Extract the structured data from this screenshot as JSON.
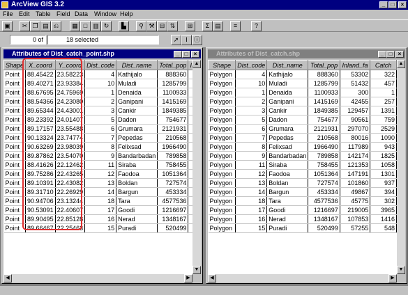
{
  "app": {
    "title": "ArcView GIS 3.2"
  },
  "menu": [
    "File",
    "Edit",
    "Table",
    "Field",
    "Data",
    "Window",
    "Help"
  ],
  "selection": {
    "selected_count": "0",
    "of_label": "of",
    "total": "18 selected"
  },
  "left_table": {
    "title": "Attributes of Dist_catch_point.shp",
    "columns": [
      "Shape",
      "X_coord",
      "Y_coord",
      "Dist_code",
      "Dist_name",
      "Total_pop",
      "In"
    ],
    "rows": [
      [
        "Point",
        "88.45422",
        "23.58223",
        "4",
        "Kathijalo",
        "888360",
        ""
      ],
      [
        "Point",
        "89.40271",
        "23.93384",
        "10",
        "Muladi",
        "1285799",
        ""
      ],
      [
        "Point",
        "88.67695",
        "24.75969",
        "1",
        "Denaida",
        "1100933",
        ""
      ],
      [
        "Point",
        "88.54366",
        "24.23080",
        "2",
        "Ganipani",
        "1415169",
        ""
      ],
      [
        "Point",
        "89.65344",
        "24.43001",
        "3",
        "Cankir",
        "1849385",
        ""
      ],
      [
        "Point",
        "89.23392",
        "24.01407",
        "5",
        "Dadon",
        "754677",
        ""
      ],
      [
        "Point",
        "89.17157",
        "23.55488",
        "6",
        "Grumara",
        "2121931",
        ""
      ],
      [
        "Point",
        "90.13324",
        "23.74774",
        "7",
        "Pepedas",
        "210568",
        ""
      ],
      [
        "Point",
        "90.63269",
        "23.98039",
        "8",
        "Felixsad",
        "1966490",
        ""
      ],
      [
        "Point",
        "89.87862",
        "23.54070",
        "9",
        "Bandarbadan",
        "789858",
        ""
      ],
      [
        "Point",
        "88.41626",
        "22.12462",
        "11",
        "Siraba",
        "758455",
        ""
      ],
      [
        "Point",
        "89.75286",
        "22.43265",
        "12",
        "Faodoa",
        "1051364",
        ""
      ],
      [
        "Point",
        "89.10391",
        "22.43082",
        "13",
        "Boldan",
        "727574",
        ""
      ],
      [
        "Point",
        "89.31710",
        "22.26929",
        "14",
        "Bargun",
        "453334",
        ""
      ],
      [
        "Point",
        "90.94706",
        "23.13244",
        "18",
        "Tara",
        "4577536",
        ""
      ],
      [
        "Point",
        "90.53091",
        "22.40607",
        "17",
        "Goodi",
        "1216697",
        ""
      ],
      [
        "Point",
        "89.90495",
        "22.85128",
        "16",
        "Nerad",
        "1348167",
        ""
      ],
      [
        "Point",
        "89.66467",
        "22.25463",
        "15",
        "Puradi",
        "520499",
        ""
      ]
    ]
  },
  "right_table": {
    "title": "Attributes of Dist_catch.shp",
    "columns": [
      "Shape",
      "Dist_code",
      "Dist_name",
      "Total_pop",
      "Inland_fa",
      "Catch"
    ],
    "rows": [
      [
        "Polygon",
        "4",
        "Kathijalo",
        "888360",
        "53302",
        "322"
      ],
      [
        "Polygon",
        "10",
        "Muladi",
        "1285799",
        "51432",
        "457"
      ],
      [
        "Polygon",
        "1",
        "Denaida",
        "1100933",
        "300",
        "1"
      ],
      [
        "Polygon",
        "2",
        "Ganipani",
        "1415169",
        "42455",
        "257"
      ],
      [
        "Polygon",
        "3",
        "Cankir",
        "1849385",
        "129457",
        "1391"
      ],
      [
        "Polygon",
        "5",
        "Dadon",
        "754677",
        "90561",
        "759"
      ],
      [
        "Polygon",
        "6",
        "Grumara",
        "2121931",
        "297070",
        "2529"
      ],
      [
        "Polygon",
        "7",
        "Pepedas",
        "210568",
        "80016",
        "1090"
      ],
      [
        "Polygon",
        "8",
        "Felixsad",
        "1966490",
        "117989",
        "943"
      ],
      [
        "Polygon",
        "9",
        "Bandarbadan",
        "789858",
        "142174",
        "1825"
      ],
      [
        "Polygon",
        "11",
        "Siraba",
        "758455",
        "121353",
        "1058"
      ],
      [
        "Polygon",
        "12",
        "Faodoa",
        "1051364",
        "147191",
        "1301"
      ],
      [
        "Polygon",
        "13",
        "Boldan",
        "727574",
        "101860",
        "937"
      ],
      [
        "Polygon",
        "14",
        "Bargun",
        "453334",
        "49867",
        "394"
      ],
      [
        "Polygon",
        "18",
        "Tara",
        "4577536",
        "45775",
        "302"
      ],
      [
        "Polygon",
        "17",
        "Goodi",
        "1216697",
        "219005",
        "3965"
      ],
      [
        "Polygon",
        "16",
        "Nerad",
        "1348167",
        "107853",
        "1416"
      ],
      [
        "Polygon",
        "15",
        "Puradi",
        "520499",
        "57255",
        "548"
      ]
    ]
  },
  "colors": {
    "titlebar": "#000080",
    "highlight": "#e03030",
    "face": "#c0c0c0"
  }
}
